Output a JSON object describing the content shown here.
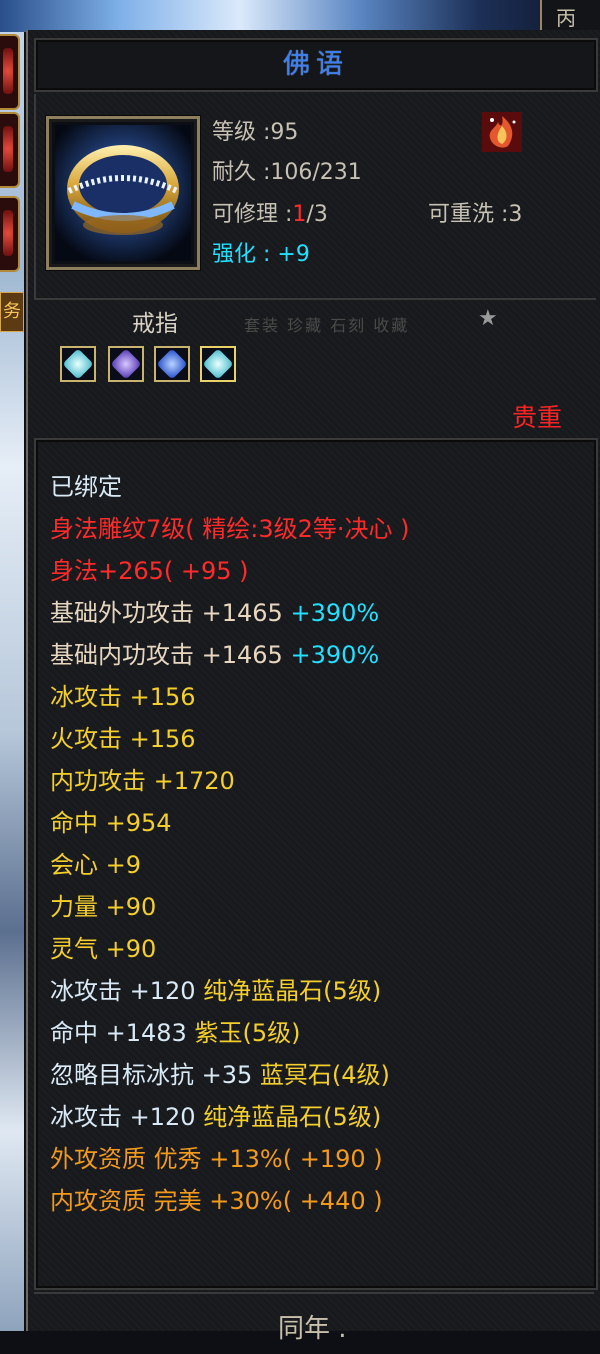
{
  "window": {
    "top_right_label": "丙"
  },
  "side_panel": {
    "tag_label": "务"
  },
  "item": {
    "name": "佛语",
    "level_text": "等级 :95",
    "durability_text": "耐久 :106/231",
    "repair_label": "可修理 :",
    "repair_used": "1",
    "repair_total": "/3",
    "rewash_text": "可重洗 :3",
    "enhance_text": "强化 : +9",
    "type_label": "戒指",
    "faded_text": "套装 珍藏 石刻 收藏",
    "rarity_label": "贵重",
    "gems": [
      "aqua-gem",
      "purple-gem",
      "blue-gem",
      "aqua-gem"
    ]
  },
  "attributes": {
    "bound": "已绑定",
    "engrave": "身法雕纹7级( 精绘:3级2等·决心 )",
    "agility": "身法+265( +95 )",
    "ext_attack": "基础外功攻击 +1465",
    "ext_attack_pct": " +390%",
    "int_attack": "基础内功攻击 +1465",
    "int_attack_pct": " +390%",
    "ice_attack": "冰攻击 +156",
    "fire_attack": "火攻击 +156",
    "inner_attack": "内功攻击 +1720",
    "hit": "命中 +954",
    "crit": "会心 +9",
    "strength": "力量 +90",
    "spirit": "灵气 +90",
    "gem1_stat": "冰攻击 +120 ",
    "gem1_name": "纯净蓝晶石(5级)",
    "gem2_stat": "命中 +1483 ",
    "gem2_name": "紫玉(5级)",
    "gem3_stat": "忽略目标冰抗 +35 ",
    "gem3_name": "蓝冥石(4级)",
    "gem4_stat": "冰攻击 +120 ",
    "gem4_name": "纯净蓝晶石(5级)",
    "ext_quality": "外攻资质  优秀 +13%( +190 )",
    "int_quality": "内攻资质  完美 +30%( +440 )"
  },
  "footer": {
    "text": "同年 ."
  },
  "colors": {
    "title_blue": "#3d7ff0",
    "rarity_red": "#ff2424",
    "stat_yellow": "#f4cf2b",
    "stat_cyan": "#22e0ff",
    "quality_orange": "#f39a1a"
  }
}
